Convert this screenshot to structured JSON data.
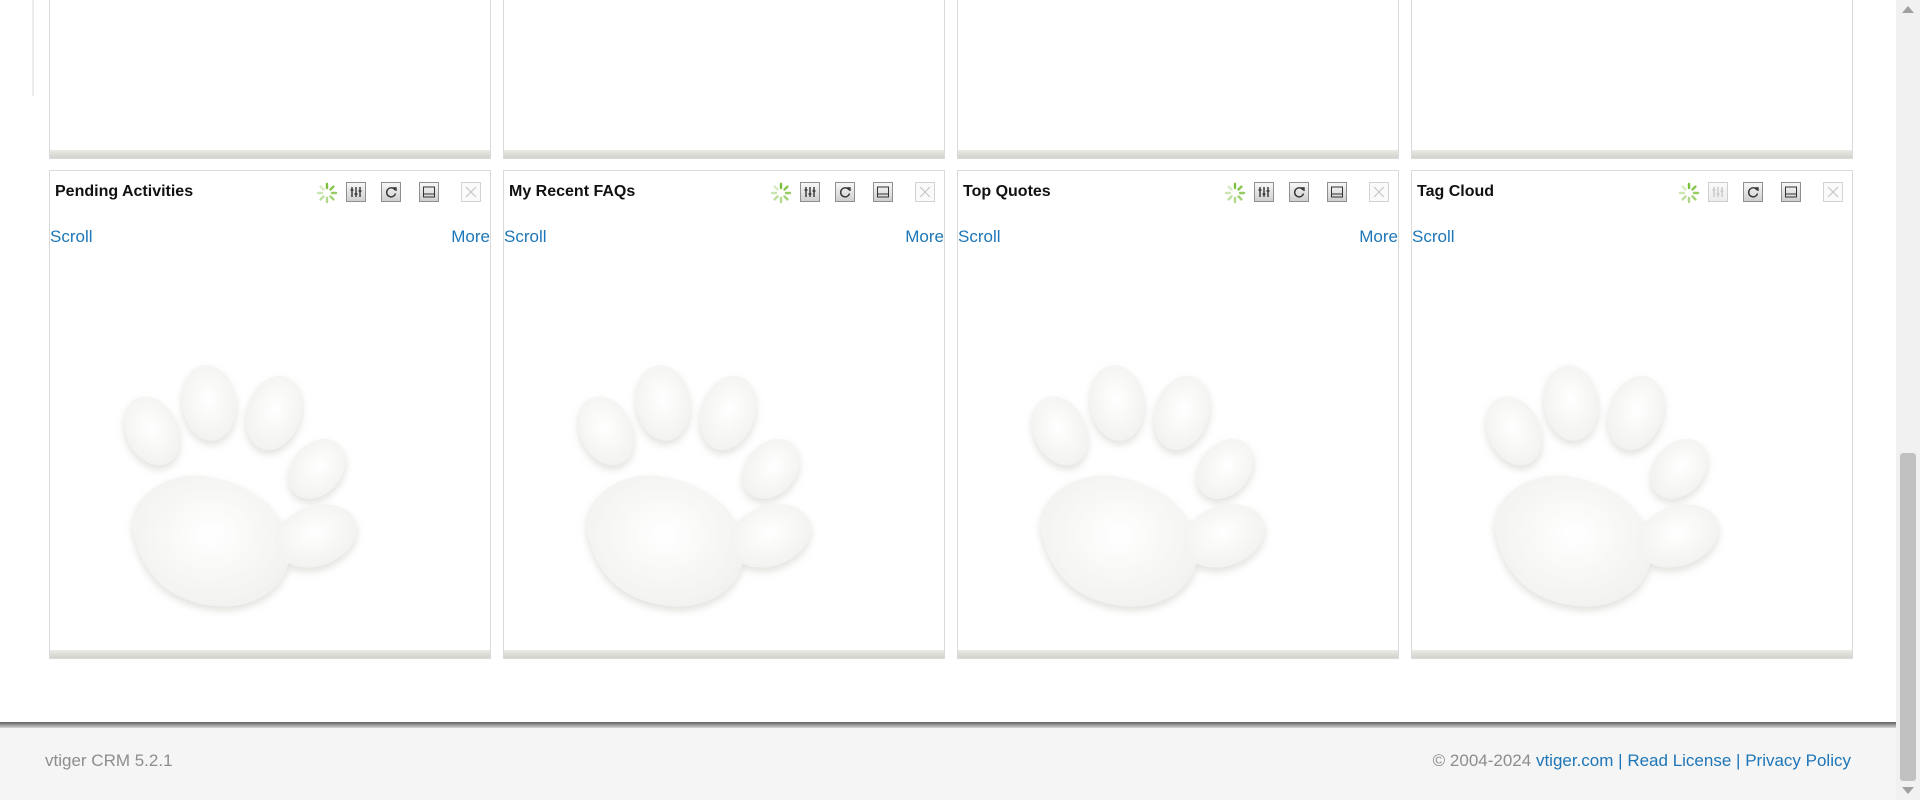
{
  "widgets_top": [
    {
      "id": "w1"
    },
    {
      "id": "w2"
    },
    {
      "id": "w3"
    },
    {
      "id": "w4"
    }
  ],
  "widgets": [
    {
      "title": "Pending Activities",
      "scroll_label": "Scroll",
      "more_label": "More",
      "config_enabled": true
    },
    {
      "title": "My Recent FAQs",
      "scroll_label": "Scroll",
      "more_label": "More",
      "config_enabled": true
    },
    {
      "title": "Top Quotes",
      "scroll_label": "Scroll",
      "more_label": "More",
      "config_enabled": true
    },
    {
      "title": "Tag Cloud",
      "scroll_label": "Scroll",
      "more_label": null,
      "config_enabled": false
    }
  ],
  "footer": {
    "version": "vtiger CRM 5.2.1",
    "copyright": "© 2004-2024",
    "site_link": "vtiger.com",
    "separator": "|",
    "license_link": "Read License",
    "privacy_link": "Privacy Policy"
  },
  "colors": {
    "link": "#1d76b8",
    "muted_text": "#8d8d8d",
    "spinner": "#7cbf3a"
  },
  "icons": [
    "loading-spinner-icon",
    "configure-icon",
    "refresh-icon",
    "minimize-icon",
    "close-icon",
    "paw-watermark-icon"
  ]
}
